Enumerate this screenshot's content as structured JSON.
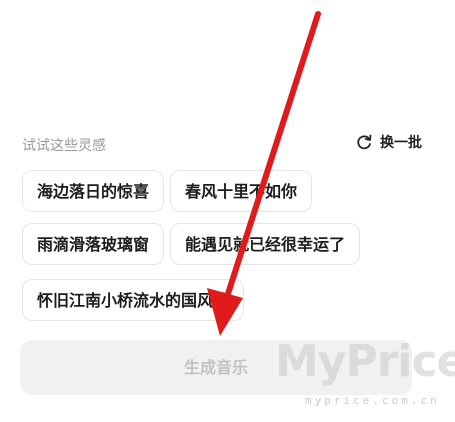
{
  "inspiration": {
    "title": "试试这些灵感",
    "refresh_label": "换一批",
    "refresh_icon": "refresh-icon",
    "chips": [
      "海边落日的惊喜",
      "春风十里不如你",
      "雨滴滑落玻璃窗",
      "能遇见就已经很幸运了",
      "怀旧江南小桥流水的国风歌"
    ]
  },
  "generate_button": {
    "label": "生成音乐"
  },
  "watermark": {
    "logo": "MyPrice",
    "url": "myprice.com.cn"
  },
  "colors": {
    "arrow": "#e01b1b",
    "button_bg": "#f1f1f1",
    "button_text": "#c2c2c2"
  }
}
